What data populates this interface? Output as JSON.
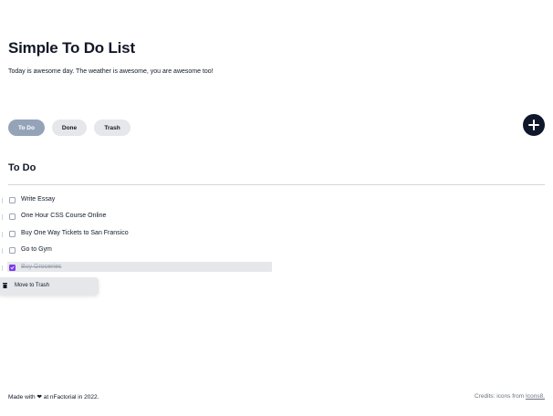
{
  "header": {
    "title": "Simple To Do List",
    "subtitle": "Today is awesome day. The weather is awesome, you are awesome too!"
  },
  "tabs": [
    {
      "label": "To Do",
      "active": true
    },
    {
      "label": "Done",
      "active": false
    },
    {
      "label": "Trash",
      "active": false
    }
  ],
  "add_button": {
    "icon": "plus-icon"
  },
  "section": {
    "title": "To Do"
  },
  "todos": [
    {
      "label": "Write Essay",
      "checked": false
    },
    {
      "label": "One Hour CSS Course Online",
      "checked": false
    },
    {
      "label": "Buy One Way Tickets to San Fransico",
      "checked": false
    },
    {
      "label": "Go to Gym",
      "checked": false
    },
    {
      "label": "Buy Groceries",
      "checked": true
    }
  ],
  "context_menu": {
    "icon": "trash-icon",
    "label": "Move to Trash"
  },
  "footer": {
    "left_prefix": "Made with",
    "heart": "❤",
    "left_suffix": "at nFactorial in 2022.",
    "right_prefix": "Credits: icons from",
    "right_link": "Icons8."
  },
  "colors": {
    "accent": "#7c3aed",
    "active_tab": "#94a3b8",
    "add_button": "#0f172a"
  }
}
